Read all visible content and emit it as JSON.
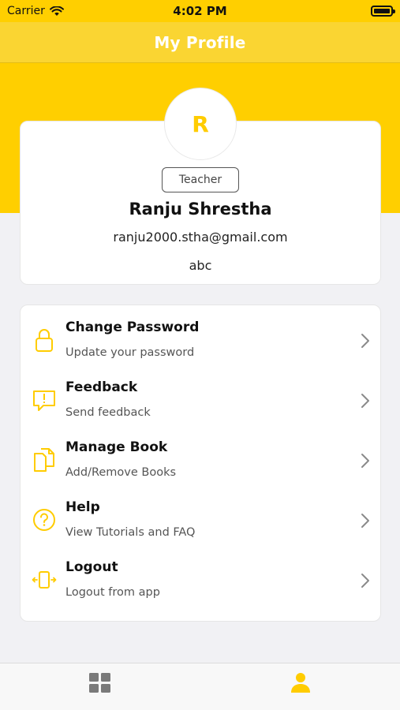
{
  "status_bar": {
    "carrier": "Carrier",
    "time": "4:02 PM"
  },
  "header": {
    "title": "My Profile"
  },
  "profile": {
    "avatar_initial": "R",
    "role": "Teacher",
    "name": "Ranju Shrestha",
    "email": "ranju2000.stha@gmail.com",
    "extra": "abc"
  },
  "menu": [
    {
      "title": "Change Password",
      "subtitle": "Update your password",
      "icon": "lock-icon"
    },
    {
      "title": "Feedback",
      "subtitle": "Send feedback",
      "icon": "feedback-icon"
    },
    {
      "title": "Manage Book",
      "subtitle": "Add/Remove Books",
      "icon": "documents-icon"
    },
    {
      "title": "Help",
      "subtitle": "View Tutorials and FAQ",
      "icon": "help-icon"
    },
    {
      "title": "Logout",
      "subtitle": "Logout from app",
      "icon": "logout-icon"
    }
  ],
  "tabs": [
    {
      "icon": "grid-icon",
      "active": false
    },
    {
      "icon": "person-icon",
      "active": true
    }
  ],
  "colors": {
    "accent": "#FFCF00",
    "nav_bar": "#FAD532",
    "inactive_tab": "#7A7A7A"
  }
}
